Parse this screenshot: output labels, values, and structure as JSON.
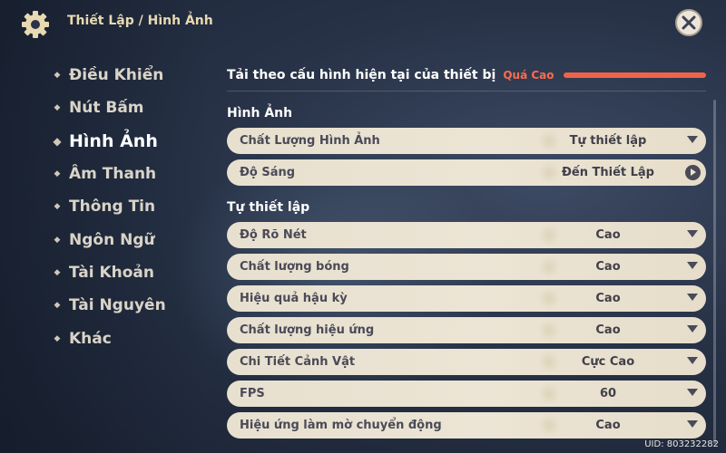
{
  "breadcrumb": "Thiết Lập / Hình Ảnh",
  "sidebar": {
    "items": [
      {
        "label": "Điều Khiển",
        "active": false
      },
      {
        "label": "Nút Bấm",
        "active": false
      },
      {
        "label": "Hình Ảnh",
        "active": true
      },
      {
        "label": "Âm Thanh",
        "active": false
      },
      {
        "label": "Thông Tin",
        "active": false
      },
      {
        "label": "Ngôn Ngữ",
        "active": false
      },
      {
        "label": "Tài Khoản",
        "active": false
      },
      {
        "label": "Tài Nguyên",
        "active": false
      },
      {
        "label": "Khác",
        "active": false
      }
    ]
  },
  "device": {
    "label": "Tải theo cấu hình hiện tại của thiết bị",
    "level": "Quá Cao",
    "bar_color": "#f0634a"
  },
  "sections": {
    "graphics_title": "Hình Ảnh",
    "custom_title": "Tự thiết lập"
  },
  "graphics_rows": [
    {
      "label": "Chất Lượng Hình Ảnh",
      "value": "Tự thiết lập",
      "control": "dropdown"
    },
    {
      "label": "Độ Sáng",
      "value": "Đến Thiết Lập",
      "control": "navigate"
    }
  ],
  "custom_rows": [
    {
      "label": "Độ Rõ Nét",
      "value": "Cao"
    },
    {
      "label": "Chất lượng bóng",
      "value": "Cao"
    },
    {
      "label": "Hiệu quả hậu kỳ",
      "value": "Cao"
    },
    {
      "label": "Chất lượng hiệu ứng",
      "value": "Cao"
    },
    {
      "label": "Chi Tiết Cảnh Vật",
      "value": "Cực Cao"
    },
    {
      "label": "FPS",
      "value": "60"
    },
    {
      "label": "Hiệu ứng làm mờ chuyển động",
      "value": "Cao"
    }
  ],
  "uid": "UID: 803232282",
  "icons": {
    "settings": "gear-icon",
    "close": "close-icon"
  }
}
